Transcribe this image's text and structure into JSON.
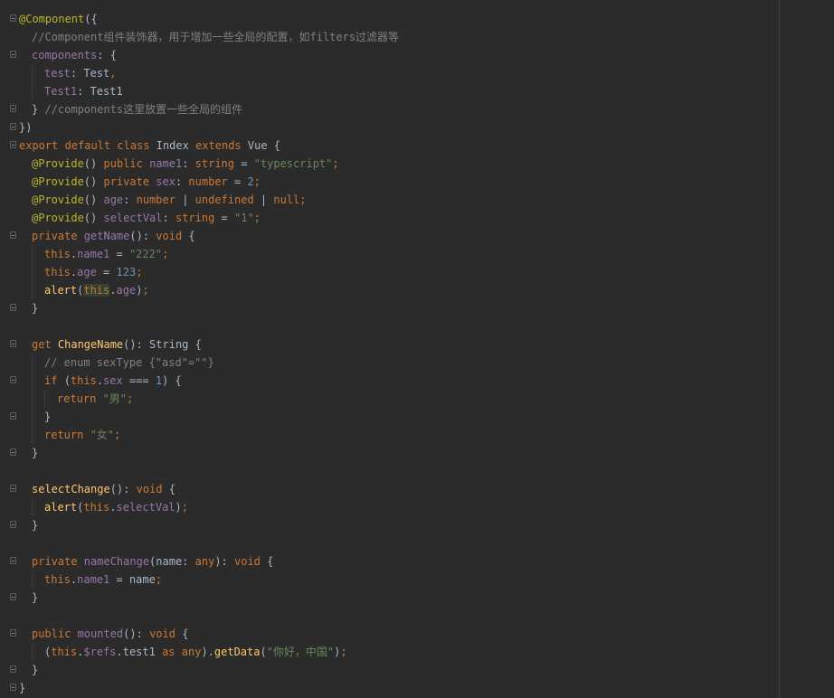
{
  "editor": {
    "language": "typescript",
    "colors": {
      "background": "#2b2b2b",
      "keyword": "#cc7832",
      "annotation": "#bbb529",
      "field": "#9876aa",
      "string": "#6a8759",
      "number": "#6897bb",
      "comment": "#808080",
      "function": "#ffc66d",
      "text": "#a9b7c6"
    },
    "lines": [
      {
        "fold": true,
        "indent": 0,
        "tokens": [
          [
            "ann",
            "@Component"
          ],
          [
            "punc",
            "({"
          ]
        ]
      },
      {
        "fold": false,
        "indent": 1,
        "tokens": [
          [
            "cmt",
            "//Component组件装饰器，用于增加一些全局的配置，如filters过滤器等"
          ]
        ]
      },
      {
        "fold": true,
        "indent": 1,
        "tokens": [
          [
            "field",
            "components"
          ],
          [
            "punc",
            ": {"
          ]
        ]
      },
      {
        "fold": false,
        "indent": 2,
        "tokens": [
          [
            "field",
            "test"
          ],
          [
            "punc",
            ": Test"
          ],
          [
            "kw",
            ","
          ]
        ]
      },
      {
        "fold": false,
        "indent": 2,
        "tokens": [
          [
            "field",
            "Test1"
          ],
          [
            "punc",
            ": Test1"
          ]
        ]
      },
      {
        "fold": true,
        "indent": 1,
        "tokens": [
          [
            "punc",
            "} "
          ],
          [
            "cmt",
            "//components这里放置一些全局的组件"
          ]
        ]
      },
      {
        "fold": true,
        "indent": 0,
        "tokens": [
          [
            "punc",
            "})"
          ]
        ]
      },
      {
        "fold": true,
        "indent": 0,
        "tokens": [
          [
            "kw",
            "export default class "
          ],
          [
            "plain",
            "Index "
          ],
          [
            "kw",
            "extends "
          ],
          [
            "plain",
            "Vue {"
          ]
        ]
      },
      {
        "fold": false,
        "indent": 1,
        "tokens": [
          [
            "ann",
            "@Provide"
          ],
          [
            "punc",
            "() "
          ],
          [
            "kw",
            "public "
          ],
          [
            "field",
            "name1"
          ],
          [
            "punc",
            ": "
          ],
          [
            "kw",
            "string "
          ],
          [
            "punc",
            "= "
          ],
          [
            "str",
            "\"typescript\""
          ],
          [
            "kw",
            ";"
          ]
        ]
      },
      {
        "fold": false,
        "indent": 1,
        "tokens": [
          [
            "ann",
            "@Provide"
          ],
          [
            "punc",
            "() "
          ],
          [
            "kw",
            "private "
          ],
          [
            "field",
            "sex"
          ],
          [
            "punc",
            ": "
          ],
          [
            "kw",
            "number "
          ],
          [
            "punc",
            "= "
          ],
          [
            "num",
            "2"
          ],
          [
            "kw",
            ";"
          ]
        ]
      },
      {
        "fold": false,
        "indent": 1,
        "tokens": [
          [
            "ann",
            "@Provide"
          ],
          [
            "punc",
            "() "
          ],
          [
            "field",
            "age"
          ],
          [
            "punc",
            ": "
          ],
          [
            "kw",
            "number "
          ],
          [
            "punc",
            "| "
          ],
          [
            "kw",
            "undefined "
          ],
          [
            "punc",
            "| "
          ],
          [
            "kw",
            "null;"
          ]
        ]
      },
      {
        "fold": false,
        "indent": 1,
        "tokens": [
          [
            "ann",
            "@Provide"
          ],
          [
            "punc",
            "() "
          ],
          [
            "field",
            "selectVal"
          ],
          [
            "punc",
            ": "
          ],
          [
            "kw",
            "string "
          ],
          [
            "punc",
            "= "
          ],
          [
            "str",
            "\"1\""
          ],
          [
            "kw",
            ";"
          ]
        ]
      },
      {
        "fold": true,
        "indent": 1,
        "tokens": [
          [
            "kw",
            "private "
          ],
          [
            "field",
            "getName"
          ],
          [
            "punc",
            "(): "
          ],
          [
            "kw",
            "void "
          ],
          [
            "punc",
            "{"
          ]
        ]
      },
      {
        "fold": false,
        "indent": 2,
        "tokens": [
          [
            "kw",
            "this"
          ],
          [
            "punc",
            "."
          ],
          [
            "field",
            "name1"
          ],
          [
            "punc",
            " = "
          ],
          [
            "str",
            "\"222\""
          ],
          [
            "kw",
            ";"
          ]
        ]
      },
      {
        "fold": false,
        "indent": 2,
        "tokens": [
          [
            "kw",
            "this"
          ],
          [
            "punc",
            "."
          ],
          [
            "field",
            "age"
          ],
          [
            "punc",
            " = "
          ],
          [
            "num",
            "123"
          ],
          [
            "kw",
            ";"
          ]
        ]
      },
      {
        "fold": false,
        "indent": 2,
        "tokens": [
          [
            "fn",
            "alert"
          ],
          [
            "punc",
            "("
          ],
          [
            "hl",
            "this"
          ],
          [
            "punc",
            "."
          ],
          [
            "field",
            "age"
          ],
          [
            "punc",
            ")"
          ],
          [
            "kw",
            ";"
          ]
        ]
      },
      {
        "fold": true,
        "indent": 1,
        "tokens": [
          [
            "punc",
            "}"
          ]
        ]
      },
      {
        "fold": false,
        "indent": 0,
        "tokens": []
      },
      {
        "fold": true,
        "indent": 1,
        "tokens": [
          [
            "kw",
            "get "
          ],
          [
            "fn",
            "ChangeName"
          ],
          [
            "punc",
            "(): String {"
          ]
        ]
      },
      {
        "fold": false,
        "indent": 2,
        "tokens": [
          [
            "cmt",
            "// enum sexType {\"asd\"=\"\"}"
          ]
        ]
      },
      {
        "fold": true,
        "indent": 2,
        "tokens": [
          [
            "kw",
            "if "
          ],
          [
            "punc",
            "("
          ],
          [
            "kw",
            "this"
          ],
          [
            "punc",
            "."
          ],
          [
            "field",
            "sex"
          ],
          [
            "punc",
            " === "
          ],
          [
            "num",
            "1"
          ],
          [
            "punc",
            ") {"
          ]
        ]
      },
      {
        "fold": false,
        "indent": 3,
        "tokens": [
          [
            "kw",
            "return "
          ],
          [
            "str",
            "\"男\""
          ],
          [
            "kw",
            ";"
          ]
        ]
      },
      {
        "fold": true,
        "indent": 2,
        "tokens": [
          [
            "punc",
            "}"
          ]
        ]
      },
      {
        "fold": false,
        "indent": 2,
        "tokens": [
          [
            "kw",
            "return "
          ],
          [
            "str",
            "\"女\""
          ],
          [
            "kw",
            ";"
          ]
        ]
      },
      {
        "fold": true,
        "indent": 1,
        "tokens": [
          [
            "punc",
            "}"
          ]
        ]
      },
      {
        "fold": false,
        "indent": 0,
        "tokens": []
      },
      {
        "fold": true,
        "indent": 1,
        "tokens": [
          [
            "fn",
            "selectChange"
          ],
          [
            "punc",
            "(): "
          ],
          [
            "kw",
            "void "
          ],
          [
            "punc",
            "{"
          ]
        ]
      },
      {
        "fold": false,
        "indent": 2,
        "tokens": [
          [
            "fn",
            "alert"
          ],
          [
            "punc",
            "("
          ],
          [
            "kw",
            "this"
          ],
          [
            "punc",
            "."
          ],
          [
            "field",
            "selectVal"
          ],
          [
            "punc",
            ")"
          ],
          [
            "kw",
            ";"
          ]
        ]
      },
      {
        "fold": true,
        "indent": 1,
        "tokens": [
          [
            "punc",
            "}"
          ]
        ]
      },
      {
        "fold": false,
        "indent": 0,
        "tokens": []
      },
      {
        "fold": true,
        "indent": 1,
        "tokens": [
          [
            "kw",
            "private "
          ],
          [
            "field",
            "nameChange"
          ],
          [
            "punc",
            "(name: "
          ],
          [
            "kw",
            "any"
          ],
          [
            "punc",
            "): "
          ],
          [
            "kw",
            "void "
          ],
          [
            "punc",
            "{"
          ]
        ]
      },
      {
        "fold": false,
        "indent": 2,
        "tokens": [
          [
            "kw",
            "this"
          ],
          [
            "punc",
            "."
          ],
          [
            "field",
            "name1"
          ],
          [
            "punc",
            " = name"
          ],
          [
            "kw",
            ";"
          ]
        ]
      },
      {
        "fold": true,
        "indent": 1,
        "tokens": [
          [
            "punc",
            "}"
          ]
        ]
      },
      {
        "fold": false,
        "indent": 0,
        "tokens": []
      },
      {
        "fold": true,
        "indent": 1,
        "tokens": [
          [
            "kw",
            "public "
          ],
          [
            "field",
            "mounted"
          ],
          [
            "punc",
            "(): "
          ],
          [
            "kw",
            "void "
          ],
          [
            "punc",
            "{"
          ]
        ]
      },
      {
        "fold": false,
        "indent": 2,
        "tokens": [
          [
            "punc",
            "("
          ],
          [
            "kw",
            "this"
          ],
          [
            "punc",
            "."
          ],
          [
            "field",
            "$refs"
          ],
          [
            "punc",
            ".test1 "
          ],
          [
            "kw",
            "as any"
          ],
          [
            "punc",
            ")."
          ],
          [
            "fn",
            "getData"
          ],
          [
            "punc",
            "("
          ],
          [
            "str",
            "\"你好，中国\""
          ],
          [
            "punc",
            ")"
          ],
          [
            "kw",
            ";"
          ]
        ]
      },
      {
        "fold": true,
        "indent": 1,
        "tokens": [
          [
            "punc",
            "}"
          ]
        ]
      },
      {
        "fold": true,
        "indent": 0,
        "tokens": [
          [
            "punc",
            "}"
          ]
        ]
      }
    ]
  }
}
